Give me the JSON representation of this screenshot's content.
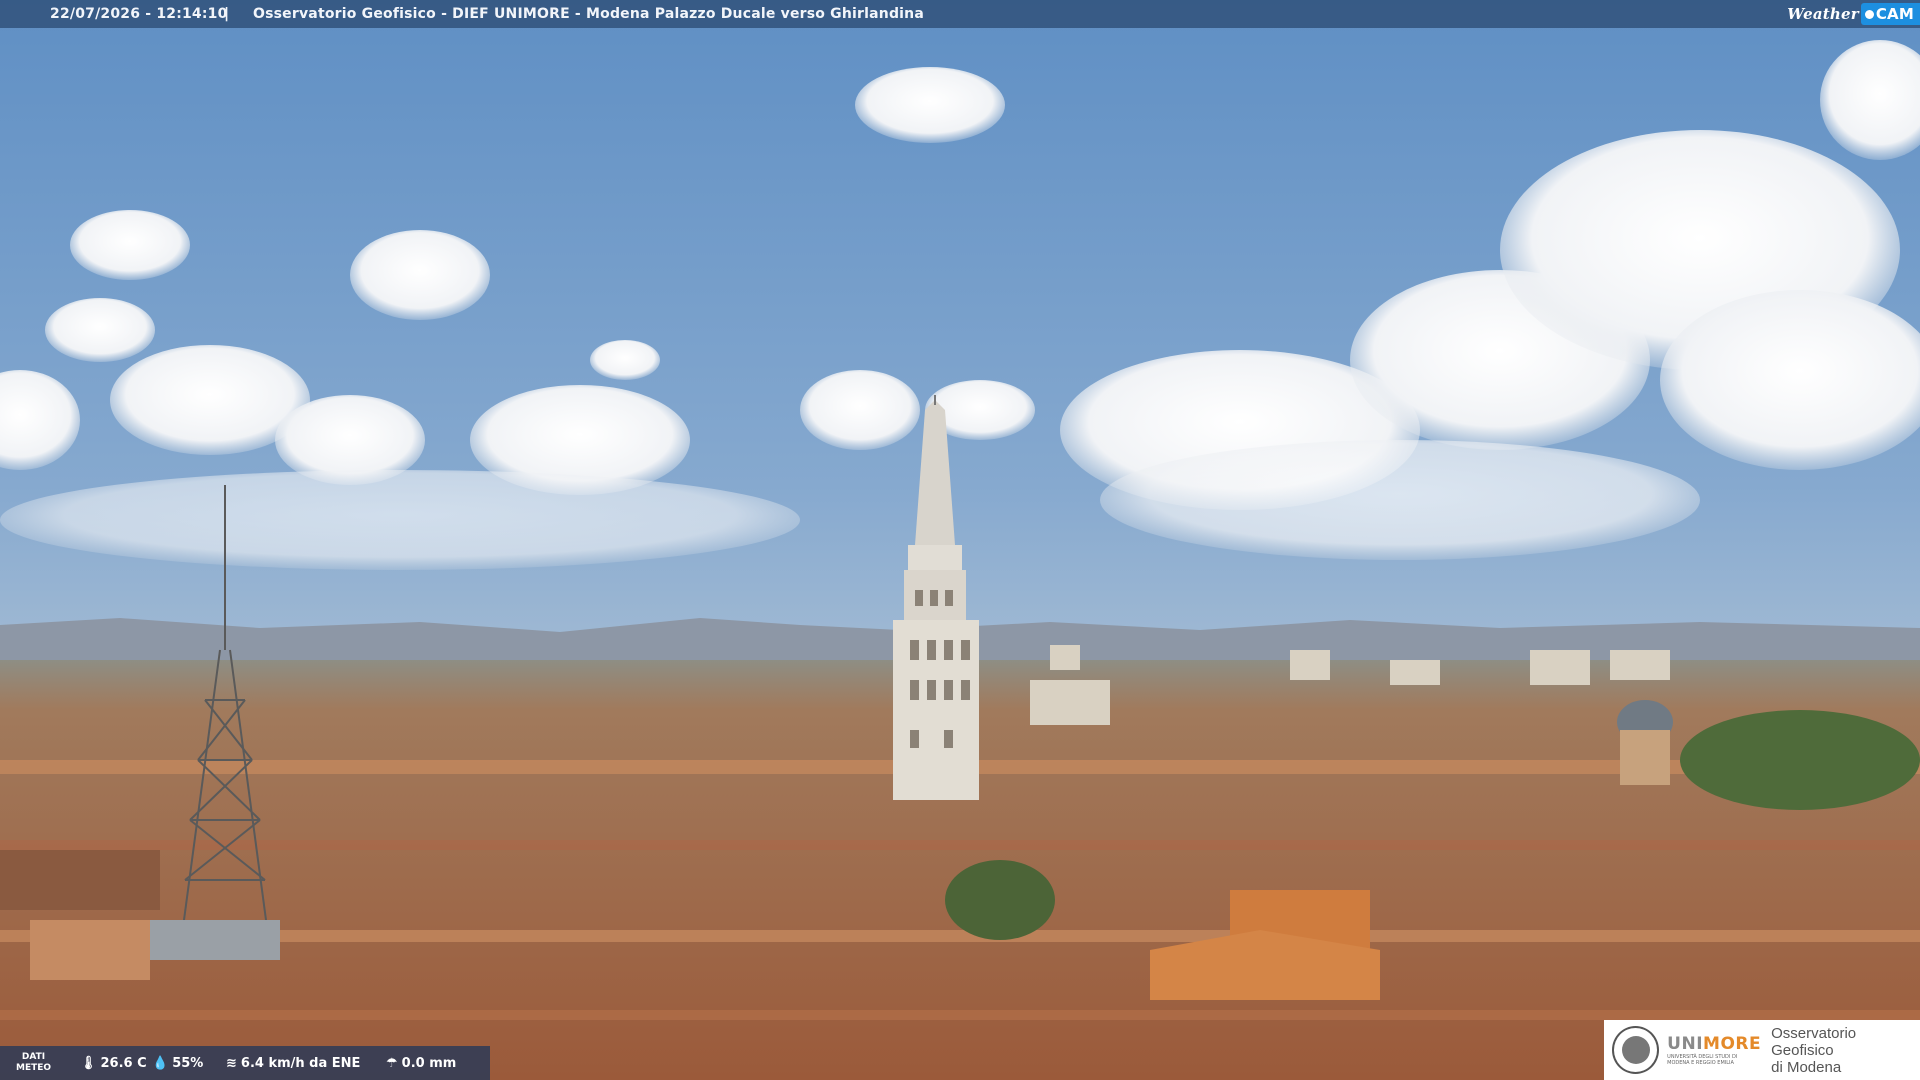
{
  "header": {
    "datetime": "22/07/2026 - 12:14:10",
    "separator": "|",
    "location": "Osservatorio Geofisico - DIEF UNIMORE - Modena Palazzo Ducale verso Ghirlandina"
  },
  "brand": {
    "weather_label": "Weather",
    "cam_label": "CAM"
  },
  "meteo": {
    "label_line1": "DATI",
    "label_line2": "METEO",
    "temperature": "26.6 C",
    "humidity": "55%",
    "wind": "6.4 km/h da ENE",
    "rain": "0.0 mm",
    "icons": [
      "thermometer-icon",
      "humidity-drop-icon",
      "wind-icon",
      "rain-icon"
    ]
  },
  "institution": {
    "logo_name_prefix": "UNI",
    "logo_name_suffix": "MORE",
    "logo_subtitle": "UNIVERSITÀ DEGLI STUDI DI MODENA E REGGIO EMILIA",
    "observatory_line1": "Osservatorio Geofisico",
    "observatory_line2": "di Modena"
  },
  "colors": {
    "sky_top": "#6f9ac9",
    "roof": "#b8754f",
    "accent_orange": "#e48a2a",
    "brand_blue": "#1d8fe0"
  }
}
